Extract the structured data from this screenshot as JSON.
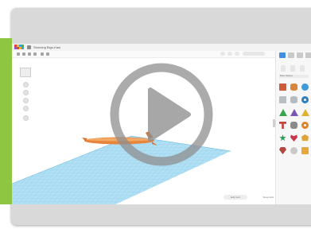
{
  "app": {
    "design_title": "Stunning Bigo-Kasi",
    "grid_settings_label": "Edit Grid",
    "snap_grid_label": "Snap Grid"
  },
  "panel": {
    "category_label": "Basic Shapes",
    "tab_labels": [
      "Import",
      "Export",
      "Send To"
    ]
  },
  "overlay": {
    "control": "play-button-icon"
  },
  "colors": {
    "accent_green": "#8ec641",
    "workplane_blue": "#9fd6ef",
    "model_orange": "#e8853d",
    "play_overlay_gray": "#8f8f8f",
    "active_tab_blue": "#3f8fe3"
  },
  "icons": [
    "play-button-icon",
    "grid-menu-icon",
    "viewcube-icon",
    "home-view-icon",
    "zoom-in-icon",
    "zoom-out-icon",
    "shape-icons"
  ]
}
